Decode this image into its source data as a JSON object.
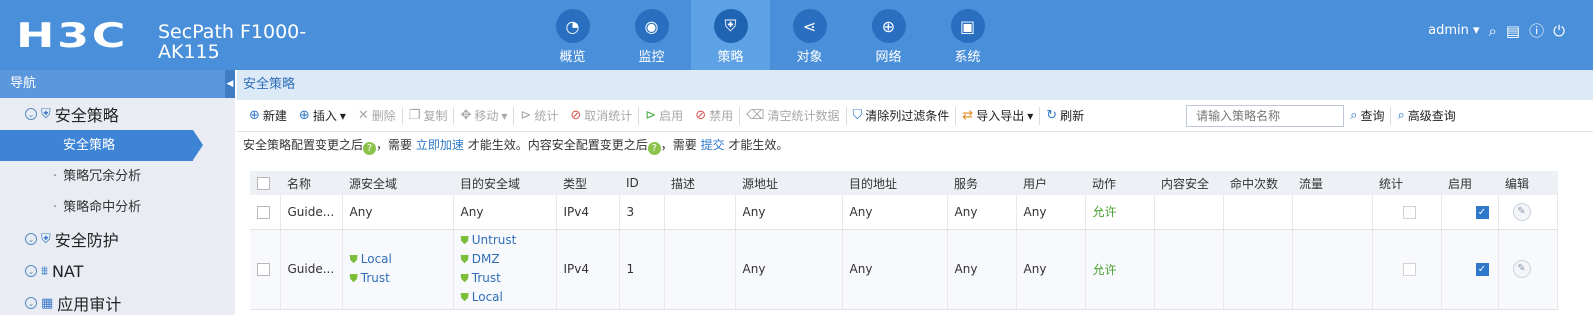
{
  "header": {
    "logo": "H3C",
    "product": "SecPath F1000-AK115",
    "nav": [
      {
        "label": "概览",
        "icon": "dashboard-icon",
        "glyph": "◔"
      },
      {
        "label": "监控",
        "icon": "monitor-icon",
        "glyph": "◉"
      },
      {
        "label": "策略",
        "icon": "shield-icon",
        "glyph": "⛨"
      },
      {
        "label": "对象",
        "icon": "share-icon",
        "glyph": "⋖"
      },
      {
        "label": "网络",
        "icon": "globe-icon",
        "glyph": "⊕"
      },
      {
        "label": "系统",
        "icon": "system-icon",
        "glyph": "▣"
      }
    ],
    "active_nav": "策略",
    "user": "admin"
  },
  "sidebar": {
    "title": "导航",
    "groups": [
      {
        "label": "安全策略",
        "items": [
          "安全策略",
          "策略冗余分析",
          "策略命中分析"
        ]
      },
      {
        "label": "安全防护"
      },
      {
        "label": "NAT"
      },
      {
        "label": "应用审计"
      }
    ],
    "active_item": "安全策略"
  },
  "main": {
    "title": "安全策略",
    "toolbar": {
      "new": "新建",
      "insert": "插入",
      "delete": "删除",
      "copy": "复制",
      "move": "移动",
      "stats": "统计",
      "cancel_stats": "取消统计",
      "enable": "启用",
      "disable": "禁用",
      "clear_stats": "清空统计数据",
      "clear_filter": "清除列过滤条件",
      "import_export": "导入导出",
      "refresh": "刷新",
      "search_placeholder": "请输入策略名称",
      "search": "查询",
      "advanced_search": "高级查询"
    },
    "notice": {
      "part1": "安全策略配置变更之后",
      "part2": "，需要",
      "link1": "立即加速",
      "part3": "才能生效。内容安全配置变更之后",
      "part4": "，需要",
      "link2": "提交",
      "part5": "才能生效。"
    },
    "columns": [
      "名称",
      "源安全域",
      "目的安全域",
      "类型",
      "ID",
      "描述",
      "源地址",
      "目的地址",
      "服务",
      "用户",
      "动作",
      "内容安全",
      "命中次数",
      "流量",
      "统计",
      "启用",
      "编辑"
    ],
    "rows": [
      {
        "name": "Guide...",
        "src_zone": [
          "Any"
        ],
        "dst_zone": [
          "Any"
        ],
        "type": "IPv4",
        "id": "3",
        "desc": "",
        "src_addr": "Any",
        "dst_addr": "Any",
        "service": "Any",
        "user": "Any",
        "action": "允许",
        "content": "",
        "hits": "",
        "traffic": "",
        "stats": false,
        "enabled": true
      },
      {
        "name": "Guide...",
        "src_zone": [
          "Local",
          "Trust"
        ],
        "dst_zone": [
          "Untrust",
          "DMZ",
          "Trust",
          "Local"
        ],
        "type": "IPv4",
        "id": "1",
        "desc": "",
        "src_addr": "Any",
        "dst_addr": "Any",
        "service": "Any",
        "user": "Any",
        "action": "允许",
        "content": "",
        "hits": "",
        "traffic": "",
        "stats": false,
        "enabled": true
      }
    ]
  }
}
